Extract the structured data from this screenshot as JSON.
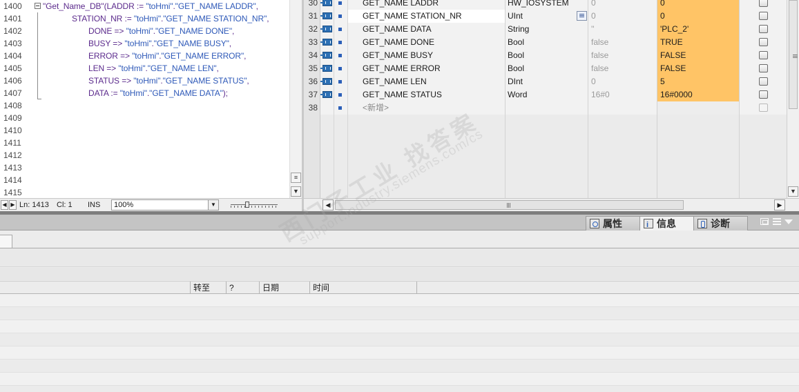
{
  "editor": {
    "lines": [
      {
        "num": "1400",
        "parts": [
          {
            "t": "\"Get_Name_DB\"",
            "c": "k"
          },
          {
            "t": "(LADDR := ",
            "c": "k"
          },
          {
            "t": "\"toHmi\"",
            "c": "s"
          },
          {
            "t": ".",
            "c": "k"
          },
          {
            "t": "\"GET_NAME LADDR\"",
            "c": "s"
          },
          {
            "t": ",",
            "c": "k"
          }
        ]
      },
      {
        "num": "1401",
        "parts": [
          {
            "t": "STATION_NR := ",
            "c": "k"
          },
          {
            "t": "\"toHmi\"",
            "c": "s"
          },
          {
            "t": ".",
            "c": "k"
          },
          {
            "t": "\"GET_NAME STATION_NR\"",
            "c": "s"
          },
          {
            "t": ",",
            "c": "k"
          }
        ]
      },
      {
        "num": "1402",
        "parts": [
          {
            "t": "DONE => ",
            "c": "k"
          },
          {
            "t": "\"toHmi\"",
            "c": "s"
          },
          {
            "t": ".",
            "c": "k"
          },
          {
            "t": "\"GET_NAME DONE\"",
            "c": "s"
          },
          {
            "t": ",",
            "c": "k"
          }
        ]
      },
      {
        "num": "1403",
        "parts": [
          {
            "t": "BUSY => ",
            "c": "k"
          },
          {
            "t": "\"toHmi\"",
            "c": "s"
          },
          {
            "t": ".",
            "c": "k"
          },
          {
            "t": "\"GET_NAME BUSY\"",
            "c": "s"
          },
          {
            "t": ",",
            "c": "k"
          }
        ]
      },
      {
        "num": "1404",
        "parts": [
          {
            "t": "ERROR => ",
            "c": "k"
          },
          {
            "t": "\"toHmi\"",
            "c": "s"
          },
          {
            "t": ".",
            "c": "k"
          },
          {
            "t": "\"GET_NAME ERROR\"",
            "c": "s"
          },
          {
            "t": ",",
            "c": "k"
          }
        ]
      },
      {
        "num": "1405",
        "parts": [
          {
            "t": "LEN => ",
            "c": "k"
          },
          {
            "t": "\"toHmi\"",
            "c": "s"
          },
          {
            "t": ".",
            "c": "k"
          },
          {
            "t": "\"GET_NAME LEN\"",
            "c": "s"
          },
          {
            "t": ",",
            "c": "k"
          }
        ]
      },
      {
        "num": "1406",
        "parts": [
          {
            "t": "STATUS => ",
            "c": "k"
          },
          {
            "t": "\"toHmi\"",
            "c": "s"
          },
          {
            "t": ".",
            "c": "k"
          },
          {
            "t": "\"GET_NAME STATUS\"",
            "c": "s"
          },
          {
            "t": ",",
            "c": "k"
          }
        ]
      },
      {
        "num": "1407",
        "parts": [
          {
            "t": "DATA := ",
            "c": "k"
          },
          {
            "t": "\"toHmi\"",
            "c": "s"
          },
          {
            "t": ".",
            "c": "k"
          },
          {
            "t": "\"GET_NAME DATA\"",
            "c": "s"
          },
          {
            "t": ");",
            "c": "k"
          }
        ]
      },
      {
        "num": "1408",
        "parts": []
      },
      {
        "num": "1409",
        "parts": []
      },
      {
        "num": "1410",
        "parts": []
      },
      {
        "num": "1411",
        "parts": []
      },
      {
        "num": "1412",
        "parts": []
      },
      {
        "num": "1413",
        "parts": []
      },
      {
        "num": "1414",
        "parts": []
      },
      {
        "num": "1415",
        "parts": []
      }
    ],
    "status": {
      "ln": "Ln: 1413",
      "cl": "Cl: 1",
      "mode": "INS",
      "zoom": "100%"
    }
  },
  "table": {
    "rows": [
      {
        "num": "30",
        "name": "GET_NAME LADDR",
        "type": "HW_IOSYSTEM",
        "default": "0",
        "monitor": "0"
      },
      {
        "num": "31",
        "name": "GET_NAME STATION_NR",
        "type": "UInt",
        "default": "0",
        "monitor": "0"
      },
      {
        "num": "32",
        "name": "GET_NAME DATA",
        "type": "String",
        "default": "''",
        "monitor": "'PLC_2'"
      },
      {
        "num": "33",
        "name": "GET_NAME DONE",
        "type": "Bool",
        "default": "false",
        "monitor": "TRUE"
      },
      {
        "num": "34",
        "name": "GET_NAME BUSY",
        "type": "Bool",
        "default": "false",
        "monitor": "FALSE"
      },
      {
        "num": "35",
        "name": "GET_NAME ERROR",
        "type": "Bool",
        "default": "false",
        "monitor": "FALSE"
      },
      {
        "num": "36",
        "name": "GET_NAME LEN",
        "type": "DInt",
        "default": "0",
        "monitor": "5"
      },
      {
        "num": "37",
        "name": "GET_NAME STATUS",
        "type": "Word",
        "default": "16#0",
        "monitor": "16#0000"
      }
    ],
    "new_row": {
      "num": "38",
      "label": "<新增>"
    },
    "monitor_color": "#ffc466",
    "accent_blue": "#2b5fb8"
  },
  "inspector": {
    "tabs": [
      {
        "label": "属性",
        "icon": "properties-icon"
      },
      {
        "label": "信息",
        "icon": "info-icon"
      },
      {
        "label": "诊断",
        "icon": "diagnostics-icon"
      }
    ],
    "columns": [
      "转至",
      "?",
      "日期",
      "时间"
    ]
  },
  "watermark": {
    "main": "西门子工业  找答案",
    "sub": "support.industry.siemens.com/cs"
  }
}
